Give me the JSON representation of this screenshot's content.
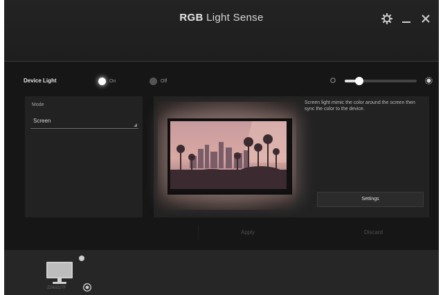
{
  "app": {
    "title_bold": "RGB",
    "title_rest": " Light Sense",
    "controls": [
      "gear-icon",
      "minimize-icon",
      "close-icon"
    ]
  },
  "device_light": {
    "label": "Device Light",
    "on_label": "On",
    "off_label": "Off",
    "selected": "On",
    "brightness_level": 0.2
  },
  "mode": {
    "label": "Mode",
    "value": "Screen"
  },
  "preview": {
    "description": "Screen light mimic the color around the screen then sync the color to the device.",
    "settings_label": "Settings"
  },
  "footer": {
    "apply_label": "Apply",
    "discard_label": "Discard"
  },
  "device": {
    "name": "Z24/31/7F"
  },
  "colors": {
    "background": "#1c1c1c",
    "accent": "#ffffff"
  }
}
